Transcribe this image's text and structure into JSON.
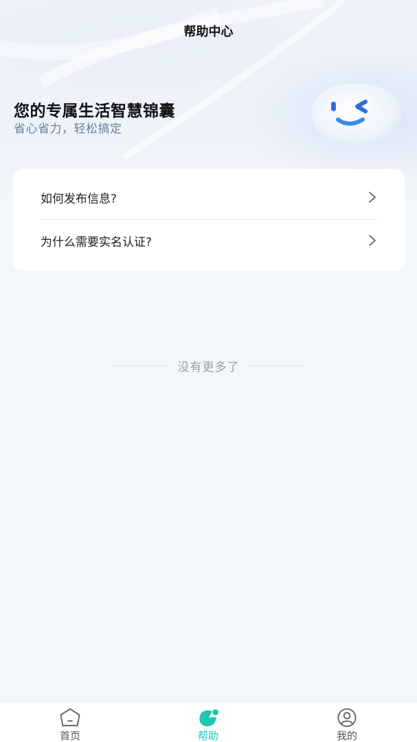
{
  "header": {
    "title": "帮助中心"
  },
  "hero": {
    "title": "您的专属生活智慧锦囊",
    "subtitle": "省心省力，轻松搞定",
    "mascot_icon": "winking-chat-bubble-mascot"
  },
  "faq": {
    "items": [
      {
        "label": "如何发布信息?",
        "icon": "chevron-right-icon"
      },
      {
        "label": "为什么需要实名认证?",
        "icon": "chevron-right-icon"
      }
    ]
  },
  "footer_note": "没有更多了",
  "tabbar": {
    "tabs": [
      {
        "label": "首页",
        "icon": "home-icon",
        "active": false
      },
      {
        "label": "帮助",
        "icon": "help-icon",
        "active": true
      },
      {
        "label": "我的",
        "icon": "profile-icon",
        "active": false
      }
    ],
    "active_color": "#1fc7b6"
  }
}
